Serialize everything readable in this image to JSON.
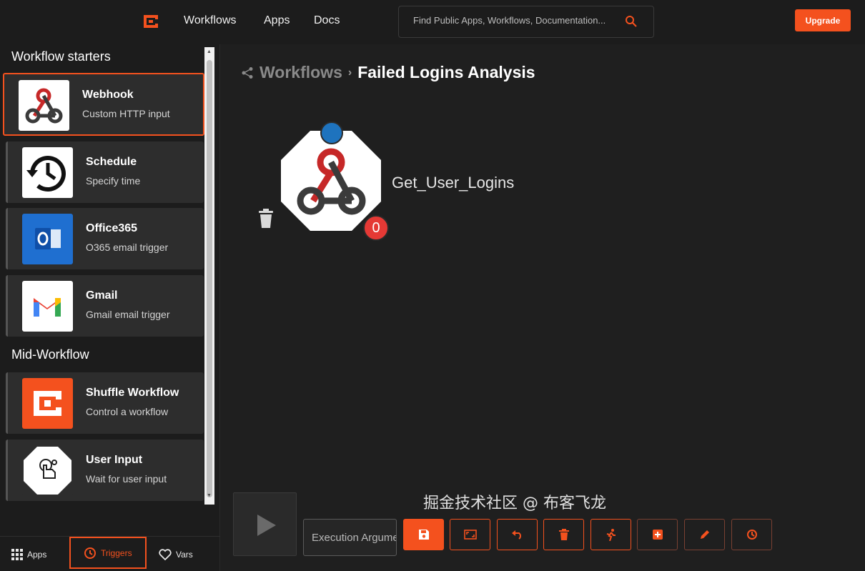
{
  "topbar": {
    "logo_icon": "shuffle-logo-icon",
    "nav": [
      {
        "label": "Workflows"
      },
      {
        "label": "Apps"
      },
      {
        "label": "Docs"
      }
    ],
    "search_placeholder": "Find Public Apps, Workflows, Documentation...",
    "upgrade_label": "Upgrade",
    "accent": "#f4511e"
  },
  "sidebar": {
    "starters_title": "Workflow starters",
    "mid_title": "Mid-Workflow",
    "starters": [
      {
        "name": "Webhook",
        "desc": "Custom HTTP input",
        "icon": "webhook-icon"
      },
      {
        "name": "Schedule",
        "desc": "Specify time",
        "icon": "clock-history-icon"
      },
      {
        "name": "Office365",
        "desc": "O365 email trigger",
        "icon": "outlook-icon"
      },
      {
        "name": "Gmail",
        "desc": "Gmail email trigger",
        "icon": "gmail-icon"
      }
    ],
    "mid": [
      {
        "name": "Shuffle Workflow",
        "desc": "Control a workflow",
        "icon": "shuffle-icon"
      },
      {
        "name": "User Input",
        "desc": "Wait for user input",
        "icon": "hand-pointer-icon"
      }
    ],
    "tabs": [
      {
        "label": "Apps",
        "icon": "grid-icon"
      },
      {
        "label": "Triggers",
        "icon": "clock-icon"
      },
      {
        "label": "Vars",
        "icon": "heart-icon"
      }
    ]
  },
  "canvas": {
    "breadcrumb_root": "Workflows",
    "breadcrumb_sep": "›",
    "breadcrumb_current": "Failed Logins Analysis",
    "node_label": "Get_User_Logins",
    "node_badge": "0",
    "exec_placeholder": "Execution Argument"
  },
  "watermark": "掘金技术社区 @ 布客飞龙"
}
